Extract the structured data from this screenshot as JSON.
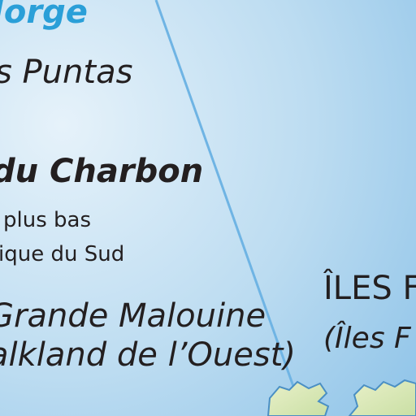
{
  "colors": {
    "sea_light": "#e6f2fa",
    "sea_mid": "#bcdcf1",
    "sea_deep": "#8ec3e8",
    "boundary_line": "#6fb4e4",
    "label_blue": "#2a9fd8",
    "label_dark": "#231f20",
    "land_light": "#e9f0c9",
    "land_mid": "#c9dfa4",
    "coast": "#4a8fc4"
  },
  "labels": {
    "gulf_name": "Jorge",
    "cape_name": "s Puntas",
    "basin_name": "du Charbon",
    "depth_note_line1": "plus bas",
    "depth_note_line2": "ique du Sud",
    "island_name": "Grande Malouine",
    "island_alt_name": "alkland de l’Ouest)",
    "isles_name": "ÎLES F",
    "isles_alt_name": "(Îles F"
  }
}
